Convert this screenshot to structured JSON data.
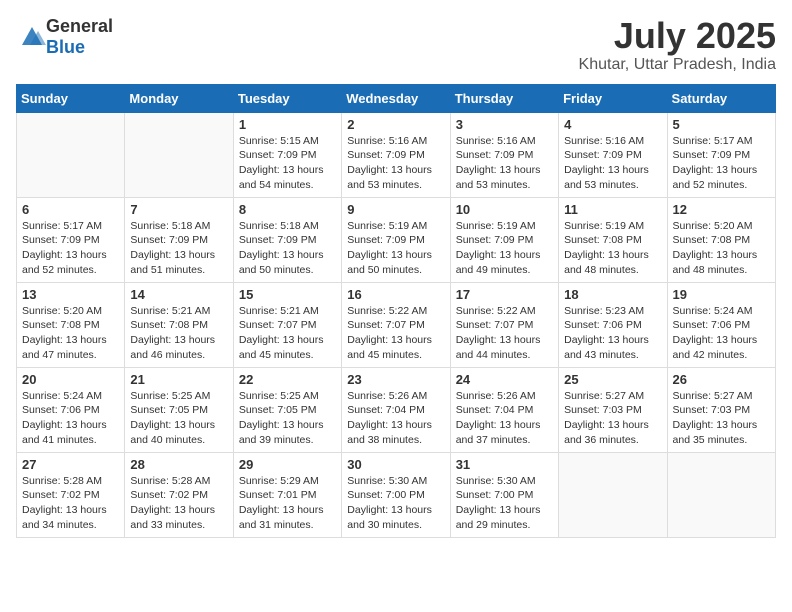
{
  "header": {
    "logo_general": "General",
    "logo_blue": "Blue",
    "month_title": "July 2025",
    "location": "Khutar, Uttar Pradesh, India"
  },
  "weekdays": [
    "Sunday",
    "Monday",
    "Tuesday",
    "Wednesday",
    "Thursday",
    "Friday",
    "Saturday"
  ],
  "weeks": [
    [
      {
        "day": "",
        "sunrise": "",
        "sunset": "",
        "daylight": ""
      },
      {
        "day": "",
        "sunrise": "",
        "sunset": "",
        "daylight": ""
      },
      {
        "day": "1",
        "sunrise": "Sunrise: 5:15 AM",
        "sunset": "Sunset: 7:09 PM",
        "daylight": "Daylight: 13 hours and 54 minutes."
      },
      {
        "day": "2",
        "sunrise": "Sunrise: 5:16 AM",
        "sunset": "Sunset: 7:09 PM",
        "daylight": "Daylight: 13 hours and 53 minutes."
      },
      {
        "day": "3",
        "sunrise": "Sunrise: 5:16 AM",
        "sunset": "Sunset: 7:09 PM",
        "daylight": "Daylight: 13 hours and 53 minutes."
      },
      {
        "day": "4",
        "sunrise": "Sunrise: 5:16 AM",
        "sunset": "Sunset: 7:09 PM",
        "daylight": "Daylight: 13 hours and 53 minutes."
      },
      {
        "day": "5",
        "sunrise": "Sunrise: 5:17 AM",
        "sunset": "Sunset: 7:09 PM",
        "daylight": "Daylight: 13 hours and 52 minutes."
      }
    ],
    [
      {
        "day": "6",
        "sunrise": "Sunrise: 5:17 AM",
        "sunset": "Sunset: 7:09 PM",
        "daylight": "Daylight: 13 hours and 52 minutes."
      },
      {
        "day": "7",
        "sunrise": "Sunrise: 5:18 AM",
        "sunset": "Sunset: 7:09 PM",
        "daylight": "Daylight: 13 hours and 51 minutes."
      },
      {
        "day": "8",
        "sunrise": "Sunrise: 5:18 AM",
        "sunset": "Sunset: 7:09 PM",
        "daylight": "Daylight: 13 hours and 50 minutes."
      },
      {
        "day": "9",
        "sunrise": "Sunrise: 5:19 AM",
        "sunset": "Sunset: 7:09 PM",
        "daylight": "Daylight: 13 hours and 50 minutes."
      },
      {
        "day": "10",
        "sunrise": "Sunrise: 5:19 AM",
        "sunset": "Sunset: 7:09 PM",
        "daylight": "Daylight: 13 hours and 49 minutes."
      },
      {
        "day": "11",
        "sunrise": "Sunrise: 5:19 AM",
        "sunset": "Sunset: 7:08 PM",
        "daylight": "Daylight: 13 hours and 48 minutes."
      },
      {
        "day": "12",
        "sunrise": "Sunrise: 5:20 AM",
        "sunset": "Sunset: 7:08 PM",
        "daylight": "Daylight: 13 hours and 48 minutes."
      }
    ],
    [
      {
        "day": "13",
        "sunrise": "Sunrise: 5:20 AM",
        "sunset": "Sunset: 7:08 PM",
        "daylight": "Daylight: 13 hours and 47 minutes."
      },
      {
        "day": "14",
        "sunrise": "Sunrise: 5:21 AM",
        "sunset": "Sunset: 7:08 PM",
        "daylight": "Daylight: 13 hours and 46 minutes."
      },
      {
        "day": "15",
        "sunrise": "Sunrise: 5:21 AM",
        "sunset": "Sunset: 7:07 PM",
        "daylight": "Daylight: 13 hours and 45 minutes."
      },
      {
        "day": "16",
        "sunrise": "Sunrise: 5:22 AM",
        "sunset": "Sunset: 7:07 PM",
        "daylight": "Daylight: 13 hours and 45 minutes."
      },
      {
        "day": "17",
        "sunrise": "Sunrise: 5:22 AM",
        "sunset": "Sunset: 7:07 PM",
        "daylight": "Daylight: 13 hours and 44 minutes."
      },
      {
        "day": "18",
        "sunrise": "Sunrise: 5:23 AM",
        "sunset": "Sunset: 7:06 PM",
        "daylight": "Daylight: 13 hours and 43 minutes."
      },
      {
        "day": "19",
        "sunrise": "Sunrise: 5:24 AM",
        "sunset": "Sunset: 7:06 PM",
        "daylight": "Daylight: 13 hours and 42 minutes."
      }
    ],
    [
      {
        "day": "20",
        "sunrise": "Sunrise: 5:24 AM",
        "sunset": "Sunset: 7:06 PM",
        "daylight": "Daylight: 13 hours and 41 minutes."
      },
      {
        "day": "21",
        "sunrise": "Sunrise: 5:25 AM",
        "sunset": "Sunset: 7:05 PM",
        "daylight": "Daylight: 13 hours and 40 minutes."
      },
      {
        "day": "22",
        "sunrise": "Sunrise: 5:25 AM",
        "sunset": "Sunset: 7:05 PM",
        "daylight": "Daylight: 13 hours and 39 minutes."
      },
      {
        "day": "23",
        "sunrise": "Sunrise: 5:26 AM",
        "sunset": "Sunset: 7:04 PM",
        "daylight": "Daylight: 13 hours and 38 minutes."
      },
      {
        "day": "24",
        "sunrise": "Sunrise: 5:26 AM",
        "sunset": "Sunset: 7:04 PM",
        "daylight": "Daylight: 13 hours and 37 minutes."
      },
      {
        "day": "25",
        "sunrise": "Sunrise: 5:27 AM",
        "sunset": "Sunset: 7:03 PM",
        "daylight": "Daylight: 13 hours and 36 minutes."
      },
      {
        "day": "26",
        "sunrise": "Sunrise: 5:27 AM",
        "sunset": "Sunset: 7:03 PM",
        "daylight": "Daylight: 13 hours and 35 minutes."
      }
    ],
    [
      {
        "day": "27",
        "sunrise": "Sunrise: 5:28 AM",
        "sunset": "Sunset: 7:02 PM",
        "daylight": "Daylight: 13 hours and 34 minutes."
      },
      {
        "day": "28",
        "sunrise": "Sunrise: 5:28 AM",
        "sunset": "Sunset: 7:02 PM",
        "daylight": "Daylight: 13 hours and 33 minutes."
      },
      {
        "day": "29",
        "sunrise": "Sunrise: 5:29 AM",
        "sunset": "Sunset: 7:01 PM",
        "daylight": "Daylight: 13 hours and 31 minutes."
      },
      {
        "day": "30",
        "sunrise": "Sunrise: 5:30 AM",
        "sunset": "Sunset: 7:00 PM",
        "daylight": "Daylight: 13 hours and 30 minutes."
      },
      {
        "day": "31",
        "sunrise": "Sunrise: 5:30 AM",
        "sunset": "Sunset: 7:00 PM",
        "daylight": "Daylight: 13 hours and 29 minutes."
      },
      {
        "day": "",
        "sunrise": "",
        "sunset": "",
        "daylight": ""
      },
      {
        "day": "",
        "sunrise": "",
        "sunset": "",
        "daylight": ""
      }
    ]
  ]
}
